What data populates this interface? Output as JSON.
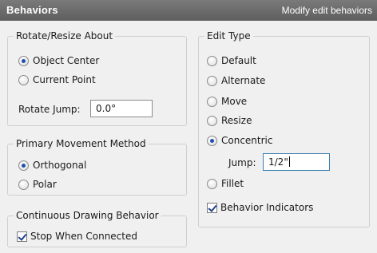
{
  "titlebar": {
    "title": "Behaviors",
    "subtitle": "Modify edit behaviors"
  },
  "rotate_resize": {
    "title": "Rotate/Resize About",
    "options": [
      {
        "label": "Object Center",
        "checked": true
      },
      {
        "label": "Current Point",
        "checked": false
      }
    ],
    "jump_label": "Rotate Jump:",
    "jump_value": "0.0°"
  },
  "primary_movement": {
    "title": "Primary Movement Method",
    "options": [
      {
        "label": "Orthogonal",
        "checked": true
      },
      {
        "label": "Polar",
        "checked": false
      }
    ]
  },
  "continuous_drawing": {
    "title": "Continuous Drawing Behavior",
    "checkbox_label": "Stop When Connected",
    "checked": true
  },
  "edit_type": {
    "title": "Edit Type",
    "options": [
      {
        "label": "Default",
        "checked": false
      },
      {
        "label": "Alternate",
        "checked": false
      },
      {
        "label": "Move",
        "checked": false
      },
      {
        "label": "Resize",
        "checked": false
      },
      {
        "label": "Concentric",
        "checked": true
      },
      {
        "label": "Fillet",
        "checked": false
      }
    ],
    "jump_label": "Jump:",
    "jump_value": "1/2\"",
    "indicators_label": "Behavior Indicators",
    "indicators_checked": true
  },
  "colors": {
    "titlebar_bg": "#6a6a6a",
    "panel_bg": "#f0f0f0",
    "accent": "#1f4fb0",
    "focus_border": "#3c7fb1"
  }
}
